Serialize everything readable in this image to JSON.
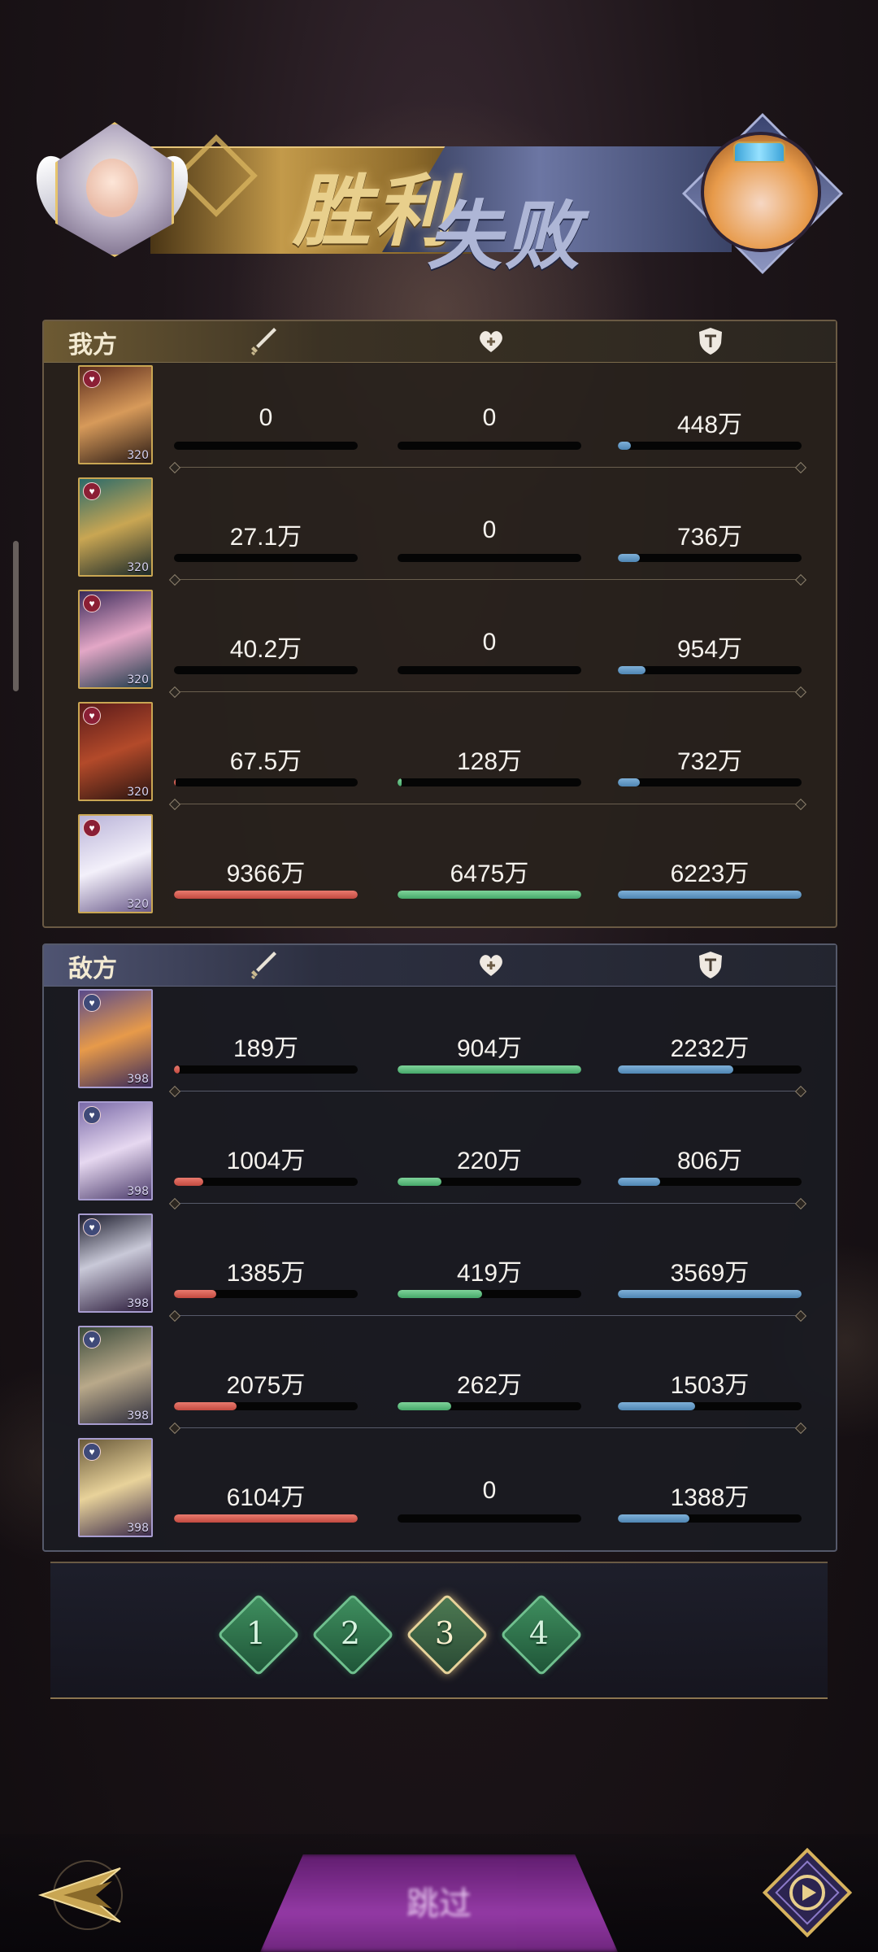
{
  "banner": {
    "win_text": "胜利",
    "lose_text": "失败"
  },
  "teams": {
    "ours": {
      "label": "我方",
      "columns": [
        "sword-icon",
        "heart-icon",
        "shield-icon"
      ],
      "rows": [
        {
          "level": "320",
          "damage": "0",
          "heal": "0",
          "tank": "448万",
          "damage_pct": 0,
          "heal_pct": 0,
          "tank_pct": 7
        },
        {
          "level": "320",
          "damage": "27.1万",
          "heal": "0",
          "tank": "736万",
          "damage_pct": 0,
          "heal_pct": 0,
          "tank_pct": 12
        },
        {
          "level": "320",
          "damage": "40.2万",
          "heal": "0",
          "tank": "954万",
          "damage_pct": 0,
          "heal_pct": 0,
          "tank_pct": 15
        },
        {
          "level": "320",
          "damage": "67.5万",
          "heal": "128万",
          "tank": "732万",
          "damage_pct": 1,
          "heal_pct": 2,
          "tank_pct": 12
        },
        {
          "level": "320",
          "damage": "9366万",
          "heal": "6475万",
          "tank": "6223万",
          "damage_pct": 100,
          "heal_pct": 100,
          "tank_pct": 100
        }
      ]
    },
    "enemy": {
      "label": "敌方",
      "columns": [
        "sword-icon",
        "heart-icon",
        "shield-icon"
      ],
      "rows": [
        {
          "level": "398",
          "damage": "189万",
          "heal": "904万",
          "tank": "2232万",
          "damage_pct": 3,
          "heal_pct": 100,
          "tank_pct": 63
        },
        {
          "level": "398",
          "damage": "1004万",
          "heal": "220万",
          "tank": "806万",
          "damage_pct": 16,
          "heal_pct": 24,
          "tank_pct": 23
        },
        {
          "level": "398",
          "damage": "1385万",
          "heal": "419万",
          "tank": "3569万",
          "damage_pct": 23,
          "heal_pct": 46,
          "tank_pct": 100
        },
        {
          "level": "398",
          "damage": "2075万",
          "heal": "262万",
          "tank": "1503万",
          "damage_pct": 34,
          "heal_pct": 29,
          "tank_pct": 42
        },
        {
          "level": "398",
          "damage": "6104万",
          "heal": "0",
          "tank": "1388万",
          "damage_pct": 100,
          "heal_pct": 0,
          "tank_pct": 39
        }
      ]
    }
  },
  "pager": {
    "pages": [
      "1",
      "2",
      "3",
      "4"
    ],
    "active_index": 2
  },
  "bottom": {
    "skip_label": "跳过"
  },
  "colors": {
    "damage": "#d05a4f",
    "heal": "#5bbf7f",
    "tank": "#6a9ec9",
    "gold": "#c9a653"
  }
}
